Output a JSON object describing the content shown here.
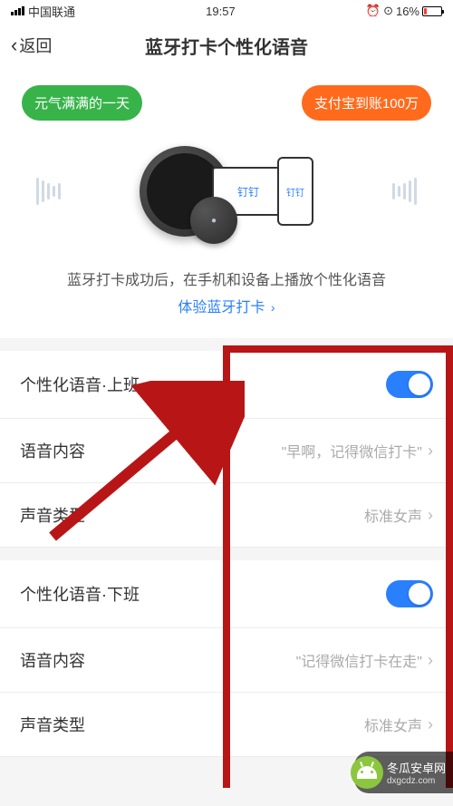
{
  "status": {
    "carrier": "中国联通",
    "time": "19:57",
    "battery": "16%",
    "alarm": "⏰"
  },
  "nav": {
    "back_label": "返回",
    "title": "蓝牙打卡个性化语音"
  },
  "hero": {
    "bubble_green": "元气满满的一天",
    "bubble_orange": "支付宝到账100万",
    "device_brand": "钉钉",
    "subtitle": "蓝牙打卡成功后，在手机和设备上播放个性化语音",
    "link_text": "体验蓝牙打卡",
    "link_arrow": "›"
  },
  "settings": {
    "group1": {
      "title": "个性化语音·上班",
      "content_label": "语音内容",
      "content_value": "\"早啊，记得微信打卡\"",
      "voice_label": "声音类型",
      "voice_value": "标准女声"
    },
    "group2": {
      "title": "个性化语音·下班",
      "content_label": "语音内容",
      "content_value": "\"记得微信打卡在走\"",
      "voice_label": "声音类型",
      "voice_value": "标准女声"
    }
  },
  "watermark": {
    "text": "冬瓜安卓网",
    "url": "dxgcdz.com"
  }
}
